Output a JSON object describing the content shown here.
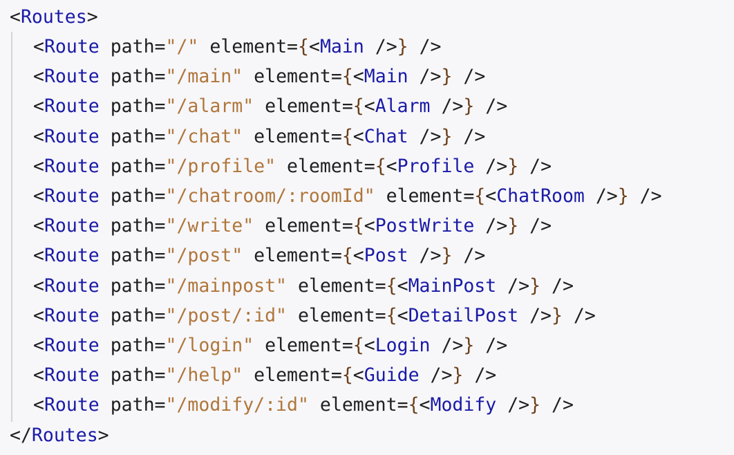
{
  "code": {
    "open_tag": "Routes",
    "close_tag": "Routes",
    "route_tag": "Route",
    "path_attr": "path",
    "element_attr": "element",
    "routes": [
      {
        "path": "\"/\"",
        "component": "Main"
      },
      {
        "path": "\"/main\"",
        "component": "Main"
      },
      {
        "path": "\"/alarm\"",
        "component": "Alarm"
      },
      {
        "path": "\"/chat\"",
        "component": "Chat"
      },
      {
        "path": "\"/profile\"",
        "component": "Profile"
      },
      {
        "path": "\"/chatroom/:roomId\"",
        "component": "ChatRoom"
      },
      {
        "path": "\"/write\"",
        "component": "PostWrite"
      },
      {
        "path": "\"/post\"",
        "component": "Post"
      },
      {
        "path": "\"/mainpost\"",
        "component": "MainPost"
      },
      {
        "path": "\"/post/:id\"",
        "component": "DetailPost"
      },
      {
        "path": "\"/login\"",
        "component": "Login"
      },
      {
        "path": "\"/help\"",
        "component": "Guide"
      },
      {
        "path": "\"/modify/:id\"",
        "component": "Modify"
      }
    ]
  }
}
